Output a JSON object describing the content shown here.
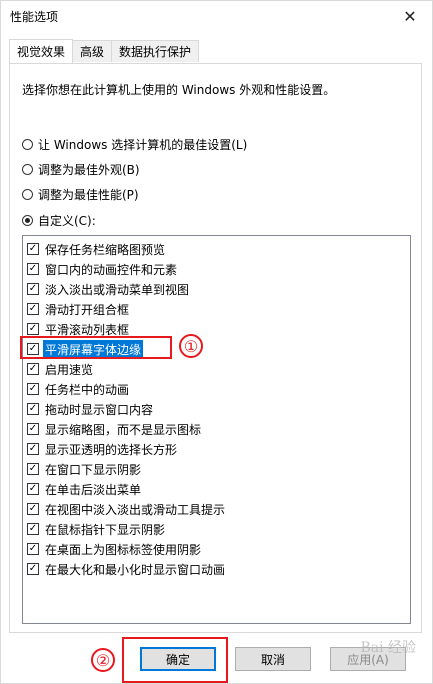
{
  "window": {
    "title": "性能选项",
    "close_glyph": "✕"
  },
  "tabs": [
    {
      "label": "视觉效果",
      "active": true
    },
    {
      "label": "高级",
      "active": false
    },
    {
      "label": "数据执行保护",
      "active": false
    }
  ],
  "description": "选择你想在此计算机上使用的 Windows 外观和性能设置。",
  "radios": [
    {
      "label": "让 Windows 选择计算机的最佳设置(L)",
      "checked": false
    },
    {
      "label": "调整为最佳外观(B)",
      "checked": false
    },
    {
      "label": "调整为最佳性能(P)",
      "checked": false
    },
    {
      "label": "自定义(C):",
      "checked": true
    }
  ],
  "effects": [
    {
      "label": "保存任务栏缩略图预览",
      "checked": true
    },
    {
      "label": "窗口内的动画控件和元素",
      "checked": true
    },
    {
      "label": "淡入淡出或滑动菜单到视图",
      "checked": true
    },
    {
      "label": "滑动打开组合框",
      "checked": true
    },
    {
      "label": "平滑滚动列表框",
      "checked": true
    },
    {
      "label": "平滑屏幕字体边缘",
      "checked": true,
      "selected": true
    },
    {
      "label": "启用速览",
      "checked": true
    },
    {
      "label": "任务栏中的动画",
      "checked": true
    },
    {
      "label": "拖动时显示窗口内容",
      "checked": true
    },
    {
      "label": "显示缩略图，而不是显示图标",
      "checked": true
    },
    {
      "label": "显示亚透明的选择长方形",
      "checked": true
    },
    {
      "label": "在窗口下显示阴影",
      "checked": true
    },
    {
      "label": "在单击后淡出菜单",
      "checked": true
    },
    {
      "label": "在视图中淡入淡出或滑动工具提示",
      "checked": true
    },
    {
      "label": "在鼠标指针下显示阴影",
      "checked": true
    },
    {
      "label": "在桌面上为图标标签使用阴影",
      "checked": true
    },
    {
      "label": "在最大化和最小化时显示窗口动画",
      "checked": true
    }
  ],
  "annotations": {
    "step1": "①",
    "step2": "②",
    "color": "#e5191e"
  },
  "buttons": {
    "ok": "确定",
    "cancel": "取消",
    "apply": "应用(A)"
  },
  "watermark": "Bai 经验",
  "colors": {
    "selection": "#0078d7",
    "default_button_border": "#0078d7"
  }
}
